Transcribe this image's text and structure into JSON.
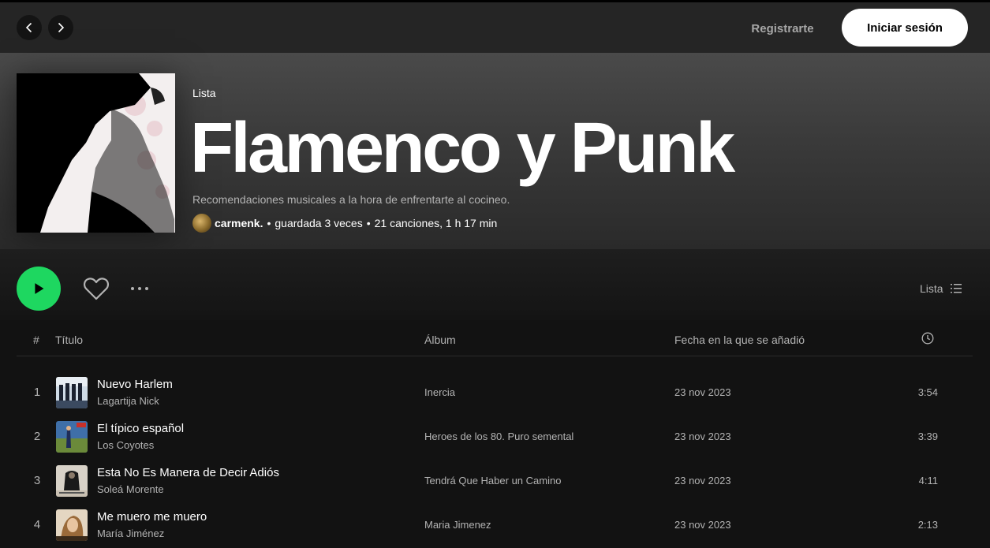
{
  "nav": {
    "back_icon": "chevron-left-icon",
    "forward_icon": "chevron-right-icon",
    "signup_label": "Registrarte",
    "login_label": "Iniciar sesión"
  },
  "playlist": {
    "type_label": "Lista",
    "title": "Flamenco y Punk",
    "description": "Recomendaciones musicales a la hora de enfrentarte al cocineo.",
    "owner": "carmenk.",
    "saves": "guardada 3 veces",
    "summary": "21 canciones, 1 h 17 min"
  },
  "actions": {
    "play_icon": "play-icon",
    "like_icon": "heart-icon",
    "more_icon": "more-options-icon",
    "view_label": "Lista",
    "view_icon": "list-icon",
    "accent": "#1ed760"
  },
  "table": {
    "headers": {
      "num": "#",
      "title": "Título",
      "album": "Álbum",
      "date": "Fecha en la que se añadió",
      "duration_icon": "clock-icon"
    },
    "rows": [
      {
        "num": "1",
        "title": "Nuevo Harlem",
        "artist": "Lagartija Nick",
        "album": "Inercia",
        "date": "23 nov 2023",
        "duration": "3:54"
      },
      {
        "num": "2",
        "title": "El típico español",
        "artist": "Los Coyotes",
        "album": "Heroes de los 80. Puro semental",
        "date": "23 nov 2023",
        "duration": "3:39"
      },
      {
        "num": "3",
        "title": "Esta No Es Manera de Decir Adiós",
        "artist": "Soleá Morente",
        "album": "Tendrá Que Haber un Camino",
        "date": "23 nov 2023",
        "duration": "4:11"
      },
      {
        "num": "4",
        "title": "Me muero me muero",
        "artist": "María Jiménez",
        "album": "Maria Jimenez",
        "date": "23 nov 2023",
        "duration": "2:13"
      }
    ]
  }
}
